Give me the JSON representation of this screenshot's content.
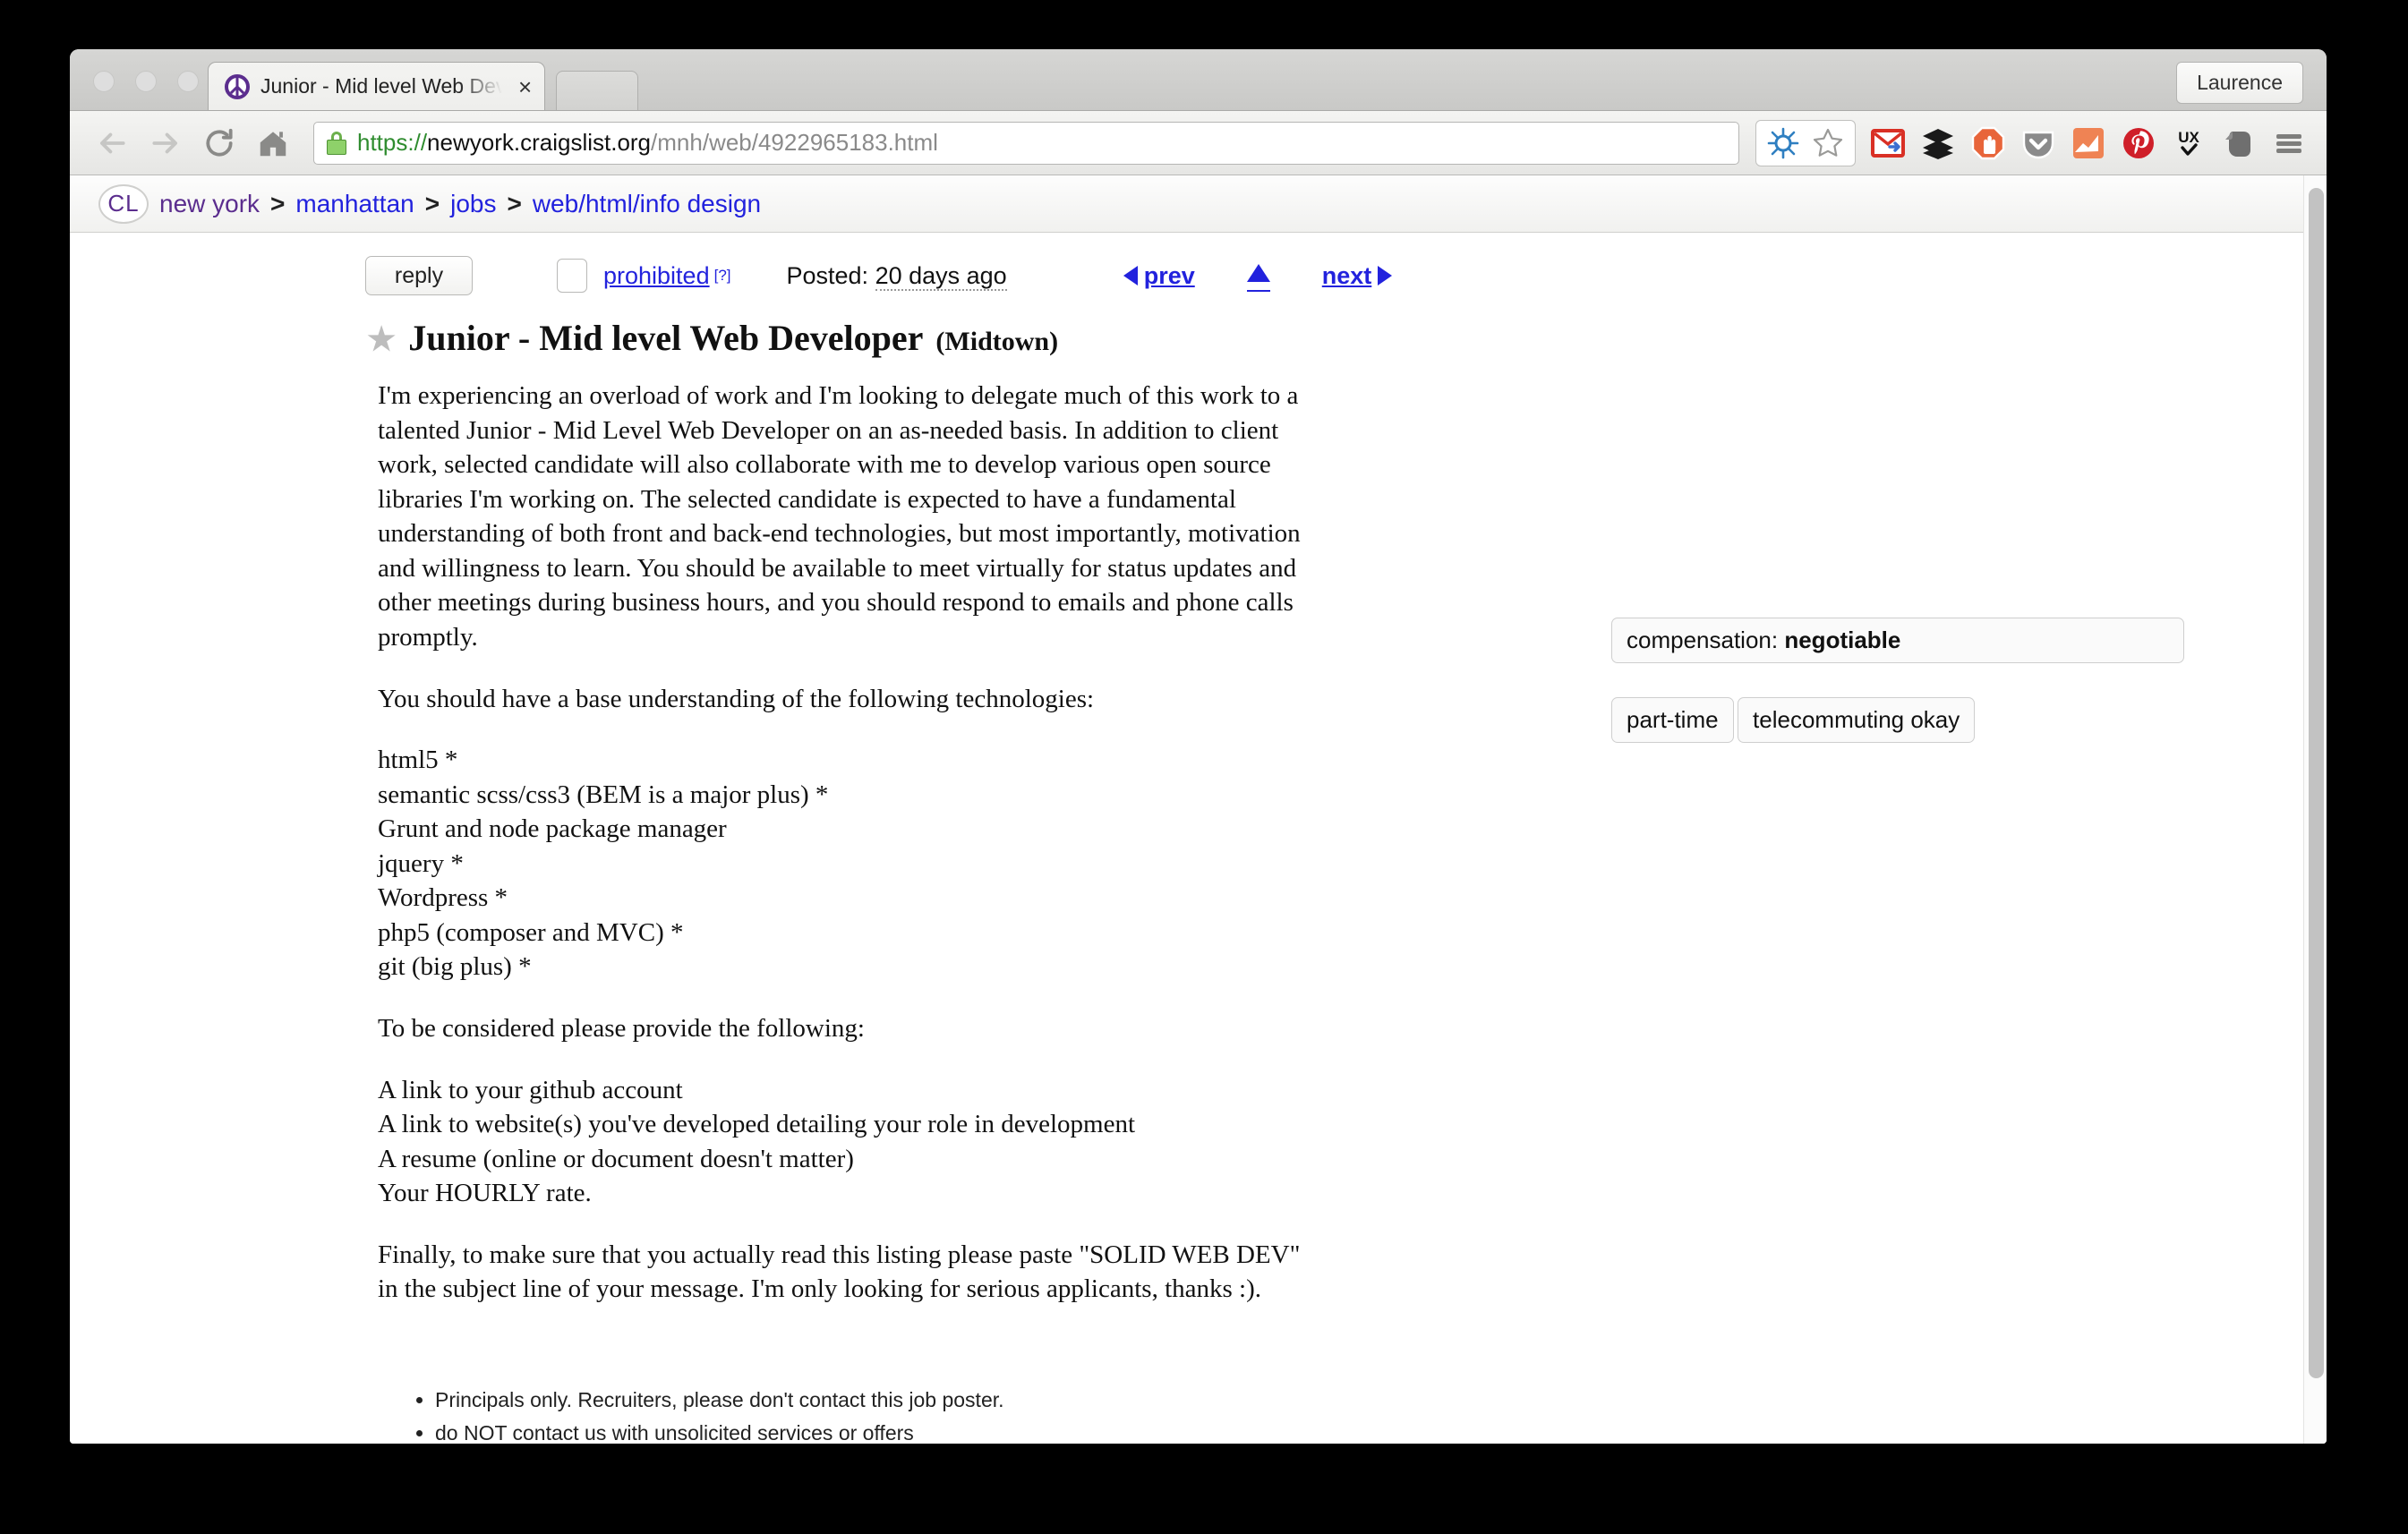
{
  "browser": {
    "tab": {
      "title": "Junior - Mid level Web Dev",
      "favicon": "peace-sign-favicon",
      "close_label": "×"
    },
    "profile_button": "Laurence",
    "nav": {
      "back": "back-arrow-icon",
      "forward": "forward-arrow-icon",
      "reload": "reload-icon",
      "home": "home-icon"
    },
    "url": {
      "scheme": "https://",
      "host": "newyork.craigslist.org",
      "path": "/mnh/web/4922965183.html",
      "lock": "secure-lock-icon"
    },
    "extensions": [
      {
        "name": "diigo-icon",
        "label": ""
      },
      {
        "name": "bookmark-star-icon",
        "label": ""
      },
      {
        "name": "gmail-icon",
        "label": ""
      },
      {
        "name": "buffer-icon",
        "label": ""
      },
      {
        "name": "adblock-icon",
        "label": ""
      },
      {
        "name": "pocket-icon",
        "label": ""
      },
      {
        "name": "chart-icon",
        "label": ""
      },
      {
        "name": "pinterest-icon",
        "label": ""
      },
      {
        "name": "ux-check-icon",
        "label": "UX"
      },
      {
        "name": "evernote-icon",
        "label": ""
      },
      {
        "name": "menu-icon",
        "label": ""
      }
    ]
  },
  "breadcrumb": {
    "logo": "CL",
    "items": [
      {
        "label": "new york",
        "state": "visited"
      },
      {
        "label": "manhattan",
        "state": "link"
      },
      {
        "label": "jobs",
        "state": "link"
      },
      {
        "label": "web/html/info design",
        "state": "link"
      }
    ],
    "separator": ">"
  },
  "postinginfo": {
    "reply_label": "reply",
    "flag_checkbox": "",
    "prohibited_label": "prohibited",
    "prohibited_help": "[?]",
    "posted_prefix": "Posted:",
    "posted_age": "20 days ago",
    "prev_label": "prev",
    "next_label": "next",
    "up_label": "▲"
  },
  "posting": {
    "star": "★",
    "title": "Junior - Mid level Web Developer",
    "location": "(Midtown)",
    "paragraph1": "I'm experiencing an overload of work and I'm looking to delegate much of this work to a talented Junior - Mid Level Web Developer on an as-needed basis. In addition to client work, selected candidate will also collaborate with me to develop various open source libraries I'm working on. The selected candidate is expected to have a fundamental understanding of both front and back-end technologies, but most importantly, motivation and willingness to learn. You should be available to meet virtually for status updates and other meetings during business hours, and you should respond to emails and phone calls promptly.",
    "tech_intro": "You should have a base understanding of the following technologies:",
    "tech_list": [
      "html5 *",
      "semantic scss/css3 (BEM is a major plus) *",
      "Grunt and node package manager",
      "jquery *",
      "Wordpress *",
      "php5 (composer and MVC) *",
      "git (big plus) *"
    ],
    "provide_intro": "To be considered please provide the following:",
    "provide_list": [
      "A link to your github account",
      "A link to website(s) you've developed detailing your role in development",
      "A resume (online or document doesn't matter)",
      "Your HOURLY rate."
    ],
    "closing": "Finally, to make sure that you actually read this listing please paste \"SOLID WEB DEV\" in the subject line of your message. I'm only looking for serious applicants, thanks :)."
  },
  "attributes": {
    "compensation_label": "compensation:",
    "compensation_value": "negotiable",
    "tags": [
      "part-time",
      "telecommuting okay"
    ]
  },
  "notices": [
    "Principals only. Recruiters, please don't contact this job poster.",
    "do NOT contact us with unsolicited services or offers"
  ]
}
